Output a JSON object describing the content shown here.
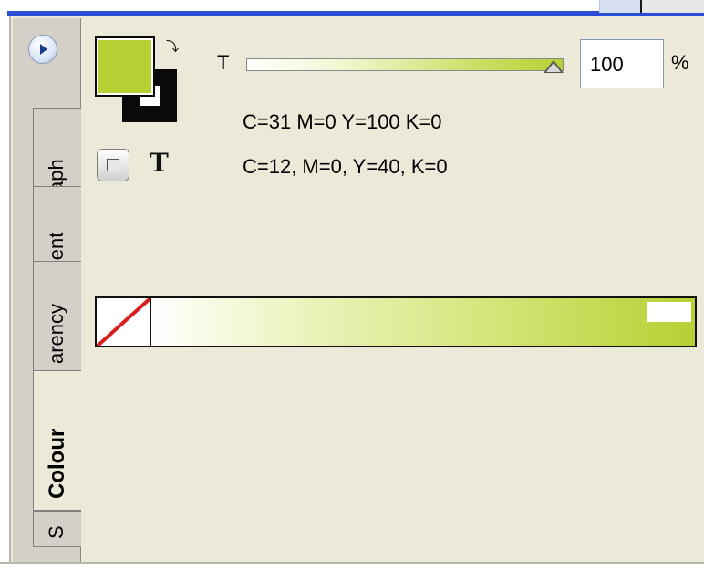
{
  "window": {
    "scroll_hint": ""
  },
  "tabs": [
    {
      "label": "aph"
    },
    {
      "label": "lient"
    },
    {
      "label": "arency"
    },
    {
      "label": "Colour"
    },
    {
      "label": "S"
    }
  ],
  "colour": {
    "fill_color": "#b5d133",
    "stroke_color": "#0a0a0a",
    "tint_label": "T",
    "tint_value": "100",
    "tint_unit": "%",
    "tint_level": 1.0,
    "info_line1": "C=31 M=0 Y=100 K=0",
    "info_line2": "C=12, M=0, Y=40, K=0",
    "text_icon": "T"
  },
  "colors": {
    "accent": "#b5d133",
    "none_slash": "#d62020",
    "panel_bg": "#ece9d8",
    "tab_bg": "#d4d0c8"
  },
  "icons": {
    "swap": "swap-arrows-icon",
    "format": "format-affects-container-icon",
    "text": "format-affects-text-icon",
    "menu": "panel-menu-icon",
    "none": "none-swatch-icon"
  }
}
